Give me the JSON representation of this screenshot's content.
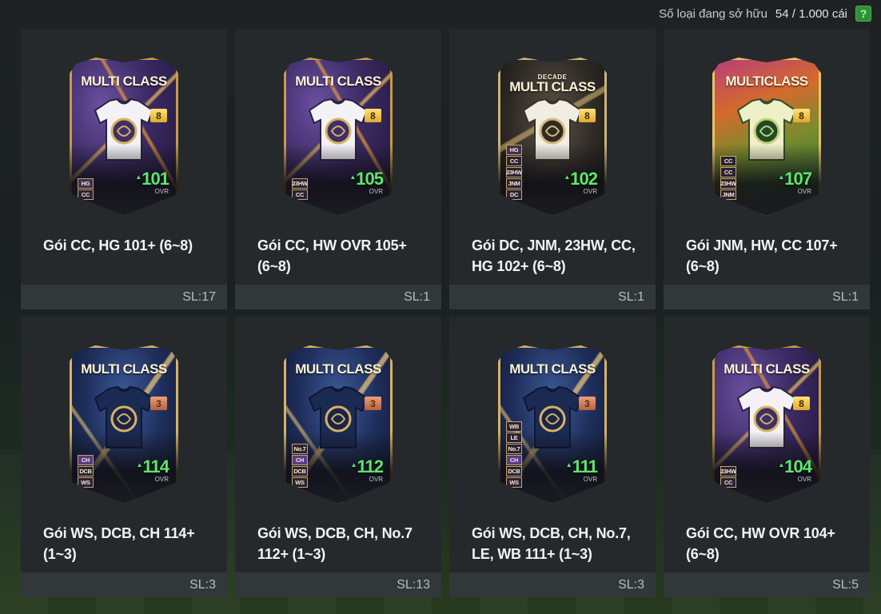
{
  "header": {
    "owned_label": "Số loại đang sở hữu",
    "owned_count": "54 / 1.000 cái",
    "help_label": "?"
  },
  "packs": [
    {
      "name": "Gói CC, HG 101+ (6~8)",
      "quantity": "SL:17",
      "card": {
        "style": "gold-purple",
        "banner": "MULTI CLASS",
        "banner_pre": "",
        "grade": "8",
        "grade_tone": "gold",
        "ovr": "101",
        "ovr_label": "OVR",
        "badges": [
          "HG",
          "CC"
        ],
        "jersey": "white-emblem"
      }
    },
    {
      "name": "Gói CC, HW OVR 105+ (6~8)",
      "quantity": "SL:1",
      "card": {
        "style": "gold-purple",
        "banner": "MULTI CLASS",
        "banner_pre": "",
        "grade": "8",
        "grade_tone": "gold",
        "ovr": "105",
        "ovr_label": "OVR",
        "badges": [
          "23HW",
          "CC"
        ],
        "jersey": "white-emblem"
      }
    },
    {
      "name": "Gói DC, JNM, 23HW, CC, HG 102+ (6~8)",
      "quantity": "SL:1",
      "card": {
        "style": "decade",
        "banner": "MULTI CLASS",
        "banner_pre": "DECADE",
        "grade": "8",
        "grade_tone": "gold",
        "ovr": "102",
        "ovr_label": "OVR",
        "badges": [
          "HG",
          "CC",
          "23HW",
          "JNM",
          "DC"
        ],
        "jersey": "white-dc"
      }
    },
    {
      "name": "Gói JNM, HW, CC 107+ (6~8)",
      "quantity": "SL:1",
      "card": {
        "style": "tropic",
        "banner": "MULTICLASS",
        "banner_pre": "",
        "grade": "8",
        "grade_tone": "gold",
        "ovr": "107",
        "ovr_label": "OVR",
        "badges": [
          "CC",
          "CC",
          "23HW",
          "JNM"
        ],
        "jersey": "cream-green"
      }
    },
    {
      "name": "Gói WS, DCB, CH 114+ (1~3)",
      "quantity": "SL:3",
      "card": {
        "style": "navy",
        "banner": "MULTI CLASS",
        "banner_pre": "",
        "grade": "3",
        "grade_tone": "bronze",
        "ovr": "114",
        "ovr_label": "OVR",
        "badges": [
          "CH",
          "DCB",
          "WS"
        ],
        "jersey": "navy-crest"
      }
    },
    {
      "name": "Gói WS, DCB, CH, No.7 112+ (1~3)",
      "quantity": "SL:13",
      "card": {
        "style": "navy",
        "banner": "MULTI CLASS",
        "banner_pre": "",
        "grade": "3",
        "grade_tone": "bronze",
        "ovr": "112",
        "ovr_label": "OVR",
        "badges": [
          "No.7",
          "CH",
          "DCB",
          "WS"
        ],
        "jersey": "navy-crest"
      }
    },
    {
      "name": "Gói WS, DCB, CH, No.7, LE, WB 111+ (1~3)",
      "quantity": "SL:3",
      "card": {
        "style": "navy",
        "banner": "MULTI CLASS",
        "banner_pre": "",
        "grade": "3",
        "grade_tone": "bronze",
        "ovr": "111",
        "ovr_label": "OVR",
        "badges": [
          "WB",
          "LE",
          "No.7",
          "CH",
          "DCB",
          "WS"
        ],
        "jersey": "navy-crest"
      }
    },
    {
      "name": "Gói CC, HW OVR 104+ (6~8)",
      "quantity": "SL:5",
      "card": {
        "style": "gold-purple",
        "banner": "MULTI CLASS",
        "banner_pre": "",
        "grade": "8",
        "grade_tone": "gold",
        "ovr": "104",
        "ovr_label": "OVR",
        "badges": [
          "23HW",
          "CC"
        ],
        "jersey": "white-emblem"
      }
    }
  ]
}
